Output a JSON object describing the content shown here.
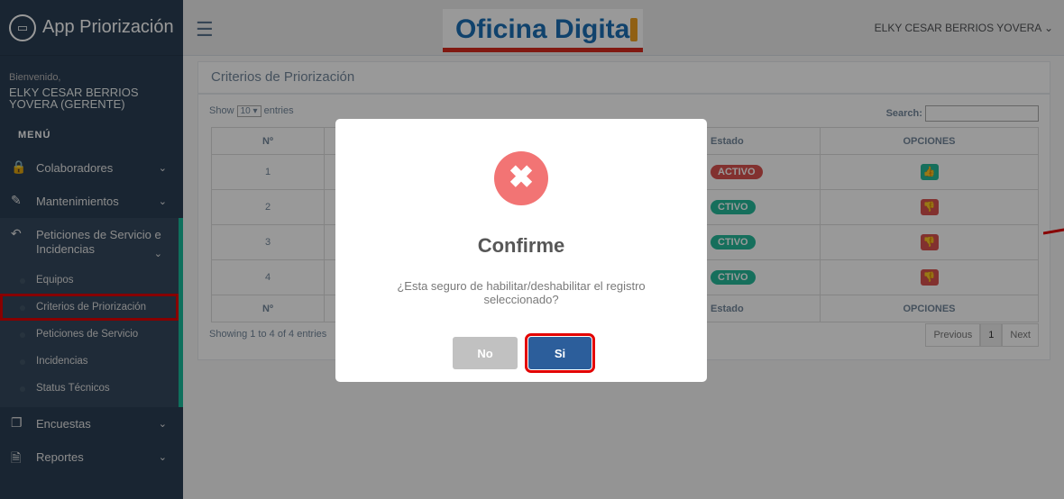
{
  "app": {
    "title": "App Priorización"
  },
  "sidebar": {
    "welcome": "Bienvenido,",
    "user": "ELKY CESAR BERRIOS YOVERA (GERENTE)",
    "menu_title": "MENÚ",
    "items": [
      {
        "label": "Colaboradores",
        "icon": "lock-icon"
      },
      {
        "label": "Mantenimientos",
        "icon": "edit-icon"
      },
      {
        "label": "Peticiones de Servicio e Incidencias",
        "icon": "reply-all-icon"
      },
      {
        "label": "Encuestas",
        "icon": "copy-icon"
      },
      {
        "label": "Reportes",
        "icon": "file-icon"
      }
    ],
    "subitems": [
      "Equipos",
      "Criterios de Priorización",
      "Peticiones de Servicio",
      "Incidencias",
      "Status Técnicos"
    ]
  },
  "topbar": {
    "logo_text": "Oficina Digital",
    "user": "ELKY CESAR BERRIOS YOVERA ⌄"
  },
  "panel": {
    "title": "Criterios de Priorización",
    "show_prefix": "Show",
    "show_value": "10",
    "show_suffix": "entries",
    "search_label": "Search:",
    "columns": [
      "Nº",
      "Estado",
      "OPCIONES"
    ],
    "rows": [
      {
        "n": "1",
        "estado": "ACTIVO"
      },
      {
        "n": "2",
        "estado": "CTIVO"
      },
      {
        "n": "3",
        "estado": "CTIVO"
      },
      {
        "n": "4",
        "estado": "CTIVO"
      }
    ],
    "first_estado": "ACTIVO",
    "footer_cols": [
      "Nº",
      "Estado",
      "OPCIONES"
    ],
    "info": "Showing 1 to 4 of 4 entries",
    "pager": {
      "prev": "Previous",
      "page": "1",
      "next": "Next"
    }
  },
  "modal": {
    "title": "Confirme",
    "text": "¿Esta seguro de habilitar/deshabilitar el registro seleccionado?",
    "no_label": "No",
    "si_label": "Si"
  },
  "colors": {
    "accent": "#1abb9c",
    "danger": "#d9534f",
    "primary": "#2c5e9b",
    "highlight": "#e30000"
  }
}
